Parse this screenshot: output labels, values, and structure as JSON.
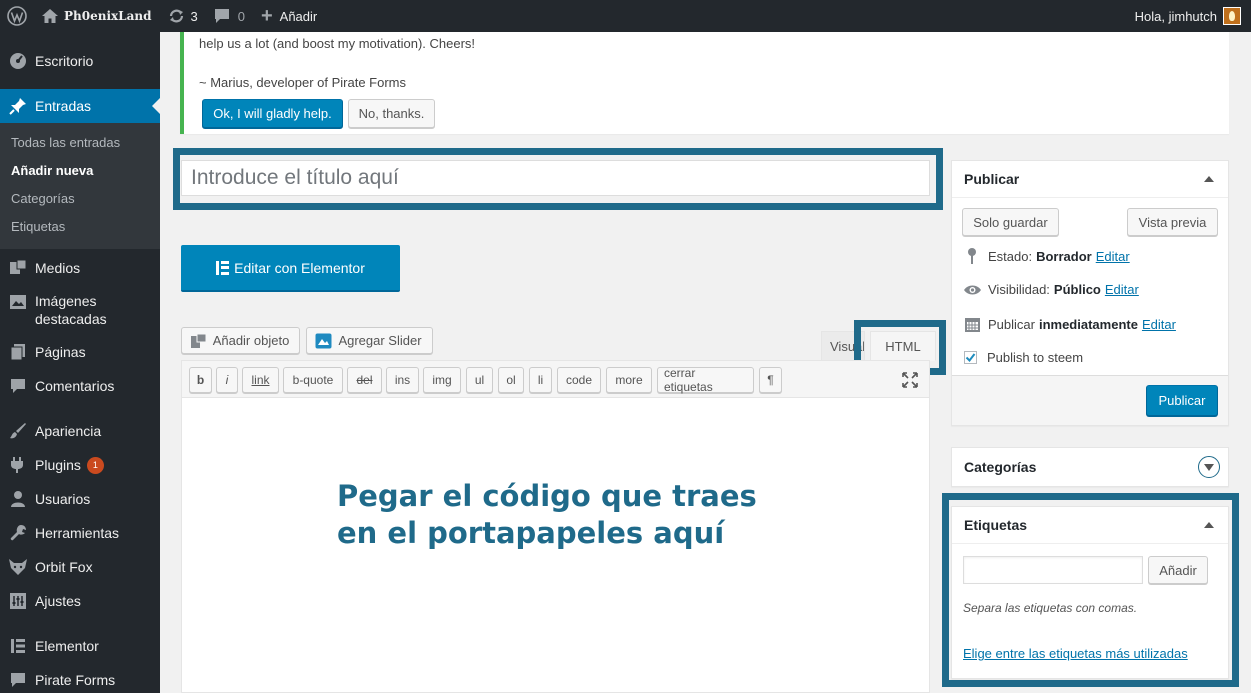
{
  "adminbar": {
    "site_name": "Ph0enixLand",
    "updates_count": "3",
    "comments_count": "0",
    "new_label": "Añadir",
    "greeting": "Hola, jimhutch"
  },
  "sidebar": {
    "items": [
      {
        "label": "Escritorio",
        "icon": "dashboard-icon"
      },
      {
        "label": "Entradas",
        "icon": "pin-icon"
      },
      {
        "label": "Medios",
        "icon": "media-icon"
      },
      {
        "label": "Imágenes destacadas",
        "icon": "images-icon"
      },
      {
        "label": "Páginas",
        "icon": "pages-icon"
      },
      {
        "label": "Comentarios",
        "icon": "comments-icon"
      },
      {
        "label": "Apariencia",
        "icon": "brush-icon"
      },
      {
        "label": "Plugins",
        "icon": "plugins-icon",
        "badge": "1"
      },
      {
        "label": "Usuarios",
        "icon": "users-icon"
      },
      {
        "label": "Herramientas",
        "icon": "tools-icon"
      },
      {
        "label": "Orbit Fox",
        "icon": "fox-icon"
      },
      {
        "label": "Ajustes",
        "icon": "settings-icon"
      },
      {
        "label": "Elementor",
        "icon": "elementor-icon"
      },
      {
        "label": "Pirate Forms",
        "icon": "pirate-icon"
      }
    ],
    "submenu": [
      "Todas las entradas",
      "Añadir nueva",
      "Categorías",
      "Etiquetas"
    ]
  },
  "notice": {
    "line1": "help us a lot (and boost my motivation). Cheers!",
    "line2": "~ Marius, developer of Pirate Forms",
    "accept_label": "Ok, I will gladly help.",
    "decline_label": "No, thanks."
  },
  "editor": {
    "title_placeholder": "Introduce el título aquí",
    "elementor_label": "Editar con Elementor",
    "add_media_label": "Añadir objeto",
    "add_slider_label": "Agregar Slider",
    "tab_visual": "Visual",
    "tab_html": "HTML",
    "quicktags": [
      "b",
      "i",
      "link",
      "b-quote",
      "del",
      "ins",
      "img",
      "ul",
      "ol",
      "li",
      "code",
      "more",
      "cerrar etiquetas",
      "¶"
    ],
    "annotation_line1": "Pegar el código que traes",
    "annotation_line2": "en el portapapeles aquí"
  },
  "publish": {
    "title": "Publicar",
    "save_draft": "Solo guardar",
    "preview": "Vista previa",
    "status_label": "Estado:",
    "status_value": "Borrador",
    "visibility_label": "Visibilidad:",
    "visibility_value": "Público",
    "schedule_label": "Publicar",
    "schedule_value": "inmediatamente",
    "edit_link": "Editar",
    "steem_label": "Publish to steem",
    "steem_checked": true,
    "publish_button": "Publicar"
  },
  "categories": {
    "title": "Categorías"
  },
  "tags": {
    "title": "Etiquetas",
    "add_button": "Añadir",
    "hint": "Separa las etiquetas con comas.",
    "choose_link": "Elige entre las etiquetas más utilizadas"
  },
  "colors": {
    "highlight": "#1f6a8a",
    "accent": "#0073aa",
    "admin_dark": "#23282d"
  }
}
